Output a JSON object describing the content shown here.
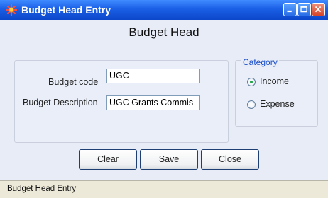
{
  "window": {
    "title": "Budget Head Entry",
    "icon": "gear-icon",
    "titlebar_color": "#1a5fe6"
  },
  "heading": "Budget Head",
  "form": {
    "code_label": "Budget code",
    "code_value": "UGC",
    "description_label": "Budget Description",
    "description_value": "UGC Grants Commis"
  },
  "category": {
    "title": "Category",
    "options": [
      {
        "label": "Income",
        "selected": true
      },
      {
        "label": "Expense",
        "selected": false
      }
    ]
  },
  "buttons": {
    "clear": "Clear",
    "save": "Save",
    "close": "Close"
  },
  "status": {
    "text": "Budget Head Entry"
  }
}
